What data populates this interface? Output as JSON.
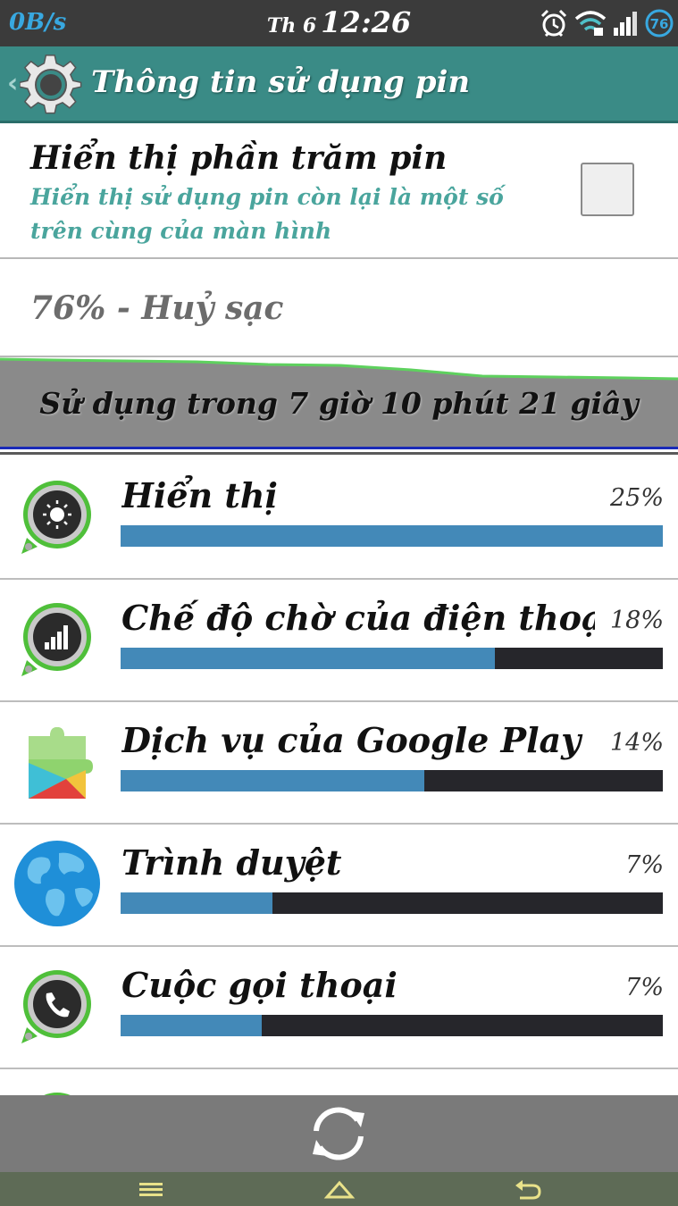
{
  "status_bar": {
    "network_speed": "0B/s",
    "day": "Th 6",
    "time": "12:26",
    "battery_level": "76",
    "icons": [
      "alarm-icon",
      "wifi-icon",
      "signal-icon",
      "battery-icon"
    ]
  },
  "action_bar": {
    "title": "Thông tin sử dụng pin",
    "icon": "gear-icon"
  },
  "preference": {
    "title": "Hiển thị phần trăm pin",
    "summary": "Hiển thị sử dụng pin còn lại là một số trên cùng của màn hình",
    "checked": false
  },
  "battery_status": "76% - Huỷ sạc",
  "usage_duration": "Sử dụng trong 7 giờ 10 phút 21 giây",
  "usage_items": [
    {
      "name": "Hiển thị",
      "percent_label": "25%",
      "bar_fraction": 1.0,
      "icon": "screen-brightness-icon"
    },
    {
      "name": "Chế độ chờ của điện thoại di động",
      "percent_label": "18%",
      "bar_fraction": 0.69,
      "icon": "cell-standby-icon"
    },
    {
      "name": "Dịch vụ của Google Play",
      "percent_label": "14%",
      "bar_fraction": 0.56,
      "icon": "google-play-services-icon"
    },
    {
      "name": "Trình duyệt",
      "percent_label": "7%",
      "bar_fraction": 0.28,
      "icon": "browser-globe-icon"
    },
    {
      "name": "Cuộc gọi thoại",
      "percent_label": "7%",
      "bar_fraction": 0.26,
      "icon": "phone-call-icon"
    }
  ],
  "colors": {
    "action_bar": "#3a8b86",
    "summary_text": "#4aa59d",
    "bar_fill": "#4389b8",
    "bar_track": "#26262b",
    "graph_line": "#5ed15e"
  },
  "bottom_bar": {
    "icon": "refresh-icon"
  },
  "nav_bar": {
    "icons": [
      "menu-icon",
      "home-icon",
      "back-icon"
    ]
  }
}
